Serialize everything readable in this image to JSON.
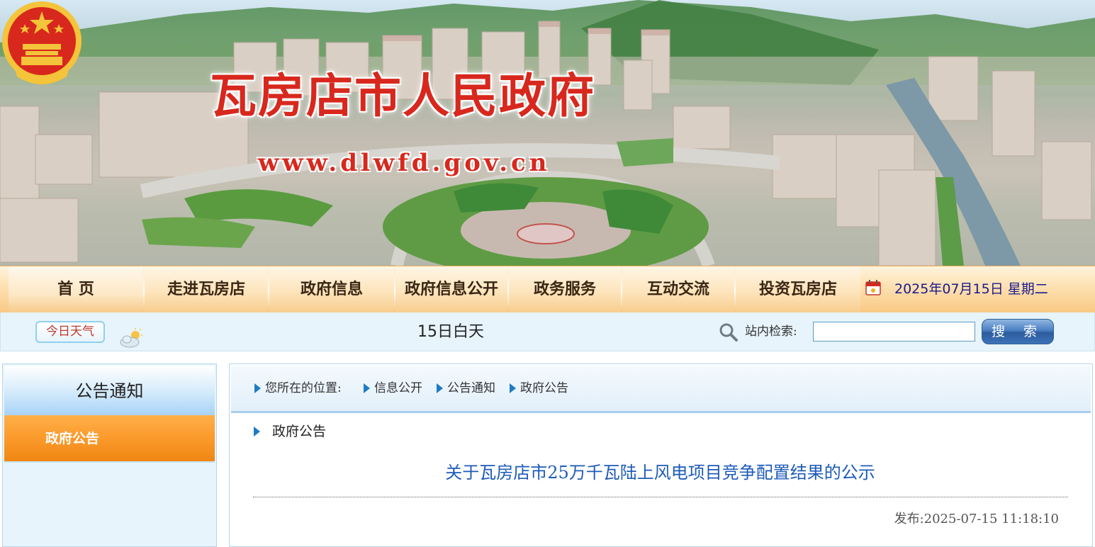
{
  "header": {
    "site_title": "瓦房店市人民政府",
    "site_url": "www.dlwfd.gov.cn"
  },
  "nav": {
    "items": [
      {
        "label": "首  页"
      },
      {
        "label": "走进瓦房店"
      },
      {
        "label": "政府信息"
      },
      {
        "label": "政府信息公开"
      },
      {
        "label": "政务服务"
      },
      {
        "label": "互动交流"
      },
      {
        "label": "投资瓦房店"
      }
    ],
    "date": "2025年07月15日  星期二",
    "calendar_icon": "calendar-icon"
  },
  "infobar": {
    "weather_button": "今日天气",
    "weather_icon": "partly-cloudy-icon",
    "weather_text": "15日白天",
    "search_label": "站内检索:",
    "search_value": "",
    "search_button": "搜 索",
    "search_icon": "magnifier-icon"
  },
  "sidebar": {
    "title": "公告通知",
    "items": [
      {
        "label": "政府公告",
        "active": true
      }
    ],
    "accent_color": "#f7931e"
  },
  "main": {
    "breadcrumb": {
      "prefix": "您所在的位置:",
      "items": [
        "信息公开",
        "公告通知",
        "政府公告"
      ]
    },
    "section_title": "政府公告",
    "article_title": "关于瓦房店市25万千瓦陆上风电项目竞争配置结果的公示",
    "publish": "发布:2025-07-15 11:18:10",
    "title_color": "#1d5bb8"
  }
}
